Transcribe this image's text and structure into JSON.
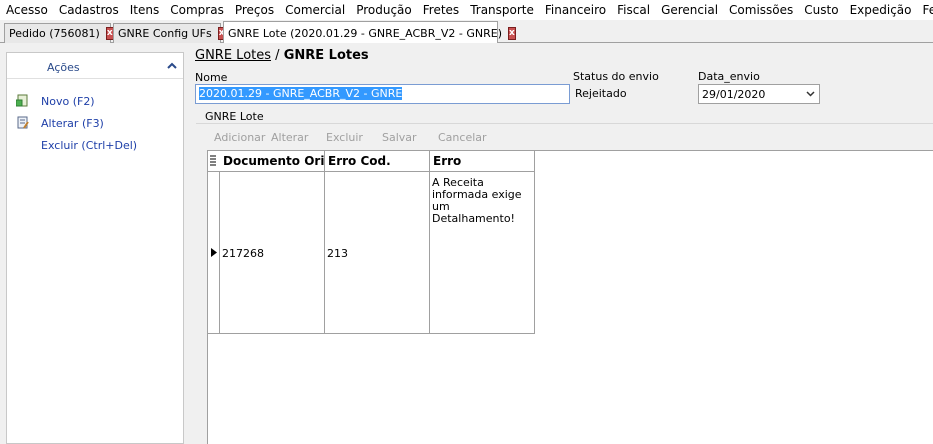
{
  "menu": [
    "Acesso",
    "Cadastros",
    "Itens",
    "Compras",
    "Preços",
    "Comercial",
    "Produção",
    "Fretes",
    "Transporte",
    "Financeiro",
    "Fiscal",
    "Gerencial",
    "Comissões",
    "Custo",
    "Expedição",
    "Ferramentas"
  ],
  "tabs": [
    {
      "label": "Pedido (756081)",
      "close": "x"
    },
    {
      "label": "GNRE Config UFs",
      "close": "x"
    },
    {
      "label": "GNRE Lote (2020.01.29 - GNRE_ACBR_V2 - GNRE)",
      "close": "x"
    }
  ],
  "sidebar": {
    "title": "Ações",
    "actions": [
      {
        "label": "Novo (F2)",
        "icon": "new-document-icon"
      },
      {
        "label": "Alterar (F3)",
        "icon": "edit-document-icon"
      },
      {
        "label": "Excluir (Ctrl+Del)",
        "icon": ""
      }
    ]
  },
  "breadcrumb": {
    "parent": "GNRE Lotes",
    "separator": "/",
    "current": "GNRE Lotes"
  },
  "form": {
    "nome_label": "Nome",
    "nome_value": "2020.01.29 - GNRE_ACBR_V2 - GNRE",
    "status_label": "Status do envio",
    "status_value": "Rejeitado",
    "data_label": "Data_envio",
    "data_value": "29/01/2020"
  },
  "group": {
    "title": "GNRE Lote",
    "toolbar": [
      "Adicionar",
      "Alterar",
      "Excluir",
      "Salvar",
      "Cancelar"
    ]
  },
  "grid": {
    "columns": [
      "Documento Origem",
      "Erro Cod.",
      "Erro"
    ],
    "rows": [
      {
        "documento": "217268",
        "erro_cod": "213",
        "erro": "A Receita informada exige um Detalhamento!"
      }
    ]
  },
  "colors": {
    "accent": "#3399ff",
    "link": "#1e3fa8",
    "close": "#c85050"
  }
}
